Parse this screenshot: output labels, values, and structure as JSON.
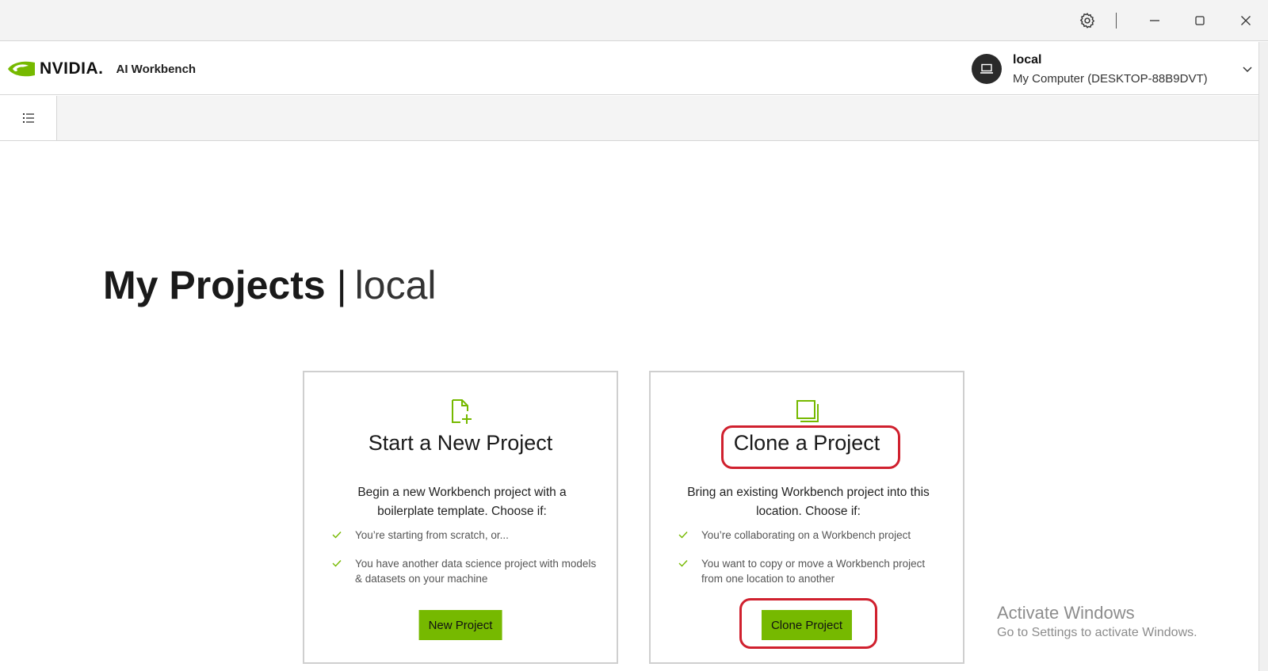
{
  "app": {
    "brand_word": "NVIDIA.",
    "product": "AI Workbench"
  },
  "window_controls": {
    "settings": "gear-icon",
    "minimize": "minimize-icon",
    "maximize": "maximize-icon",
    "close": "close-icon"
  },
  "location": {
    "name": "local",
    "description": "My Computer (DESKTOP-88B9DVT)"
  },
  "page": {
    "title": "My Projects",
    "separator": "|",
    "location": "local"
  },
  "cards": {
    "new": {
      "title": "Start a New Project",
      "description": "Begin a new Workbench project with a boilerplate template. Choose if:",
      "items": [
        "You’re starting from scratch, or...",
        "You have another data science project with models & datasets on your machine"
      ],
      "button": "New Project"
    },
    "clone": {
      "title": "Clone a Project",
      "description": "Bring an existing Workbench project into this location. Choose if:",
      "items": [
        "You’re collaborating on a Workbench project",
        "You want to copy or move a Workbench project from one location to another"
      ],
      "button": "Clone Project"
    }
  },
  "watermark": {
    "line1": "Activate Windows",
    "line2": "Go to Settings to activate Windows."
  },
  "colors": {
    "accent": "#76b900",
    "annotation": "#d0202e"
  }
}
